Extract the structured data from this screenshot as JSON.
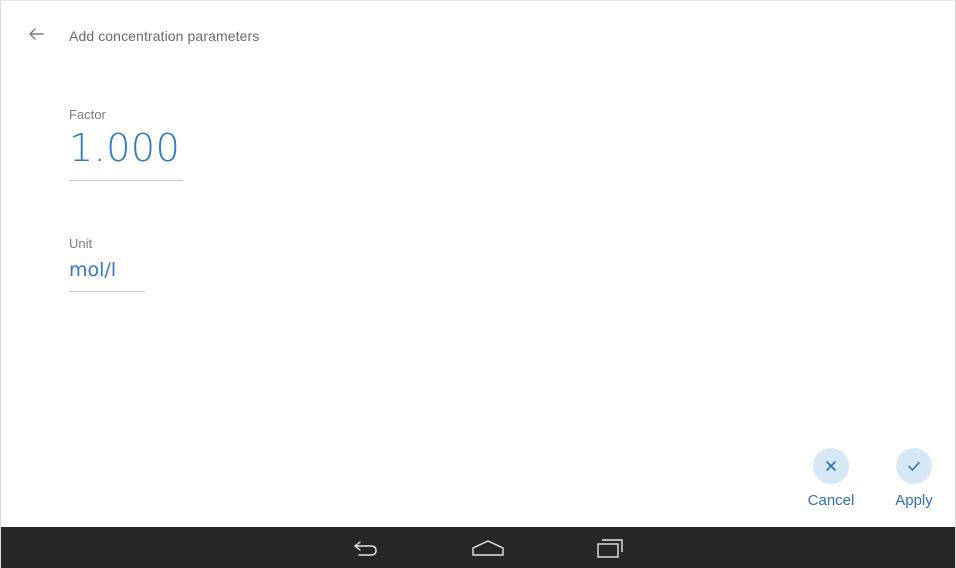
{
  "header": {
    "title": "Add concentration parameters",
    "back_icon": "arrow-left-icon"
  },
  "factor": {
    "label": "Factor",
    "value": "1.000"
  },
  "unit": {
    "label": "Unit",
    "value": "mol/l"
  },
  "actions": {
    "cancel_label": "Cancel",
    "apply_label": "Apply",
    "cancel_icon": "close-icon",
    "apply_icon": "check-icon"
  },
  "navbar": {
    "back_icon": "nav-back-icon",
    "home_icon": "nav-home-icon",
    "recent_icon": "nav-recent-apps-icon"
  },
  "colors": {
    "accent": "#2f78c4",
    "button_circle": "#d6e7f6",
    "navbar": "#262626"
  }
}
